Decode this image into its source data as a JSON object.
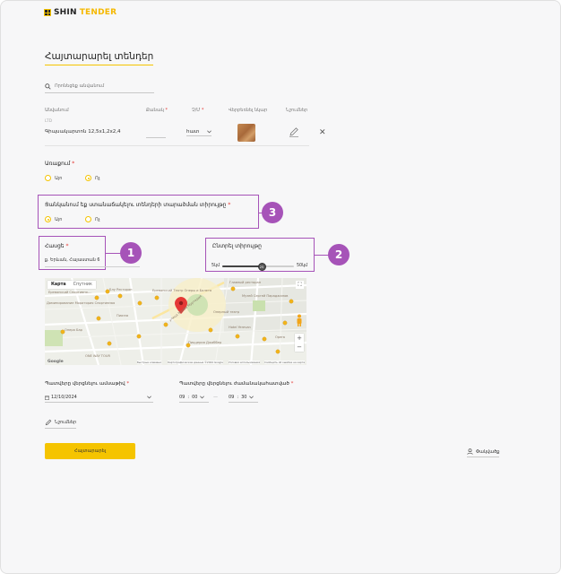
{
  "brand": {
    "part1": "SHIN",
    "part2": "TENDER",
    "accent": "#f5c400",
    "annotation_color": "#a653b8"
  },
  "page": {
    "title": "Հայտարարել տենդեր"
  },
  "search": {
    "placeholder": "Որոնեցեք անվանում"
  },
  "table": {
    "headers": {
      "name": "Անվանում",
      "qty": "Քանակ",
      "unit": "Չ/Մ",
      "image": "Վերբեռնել նկար",
      "edit": "Նշումներ"
    },
    "rows": [
      {
        "sub": "LTD",
        "name": "Գիպսակարտոն 12,5x1,2x2,4",
        "unit": "հատ"
      }
    ]
  },
  "delivery": {
    "label": "Առաքում",
    "options": [
      "Այո",
      "Ոչ"
    ],
    "selected": "Ոչ"
  },
  "visibility": {
    "label": "Ցանկանում եք ստանաճակելու տենդերի տարածման տիրույթը",
    "options": [
      "Այո",
      "Ոչ"
    ],
    "selected": "Այո"
  },
  "address": {
    "label": "Հասցե",
    "value": "ք. Երևան, Հայաստան 6"
  },
  "radius": {
    "label": "Ընտրել տիրույթը",
    "min": "5կմ",
    "max": "50կմ",
    "current_label": "25",
    "fraction": 0.55
  },
  "markers": [
    "1",
    "2",
    "3"
  ],
  "map": {
    "tab_map": "Карта",
    "tab_satellite": "Спутник",
    "labels": [
      "Ереванский Спортивно-...",
      "Блу Ресторан",
      "Доминирование Моратория Спортивная",
      "Ереванский Театр Оперы и Балета",
      "Пиазза",
      "Опера Бар",
      "Оперный театр",
      "Главный ресторан",
      "Hotel Yerevan",
      "ONE WAY TOUR",
      "Пиццерия Джаббер",
      "Opera",
      "Музей Сергей Параджанов",
      "улица Мамбо Муртадия"
    ],
    "footer": [
      "Быстрые клавиши",
      "Картографические данные ©2024 Google",
      "Условия использования",
      "Сообщить об ошибке на карте"
    ],
    "google": "Google"
  },
  "start_date": {
    "label": "Պատվերը վերցնելու ամսաթիվ",
    "value": "12/10/2024"
  },
  "end_time": {
    "label": "Պատվերը վերցնելու ժամանակահատված",
    "h1": "09",
    "m1": "00",
    "sep": "—",
    "h2": "09",
    "m2": "30"
  },
  "note": {
    "label": "Նշումներ"
  },
  "actions": {
    "submit": "Հայտարարել",
    "exit": "Փակվածք"
  }
}
